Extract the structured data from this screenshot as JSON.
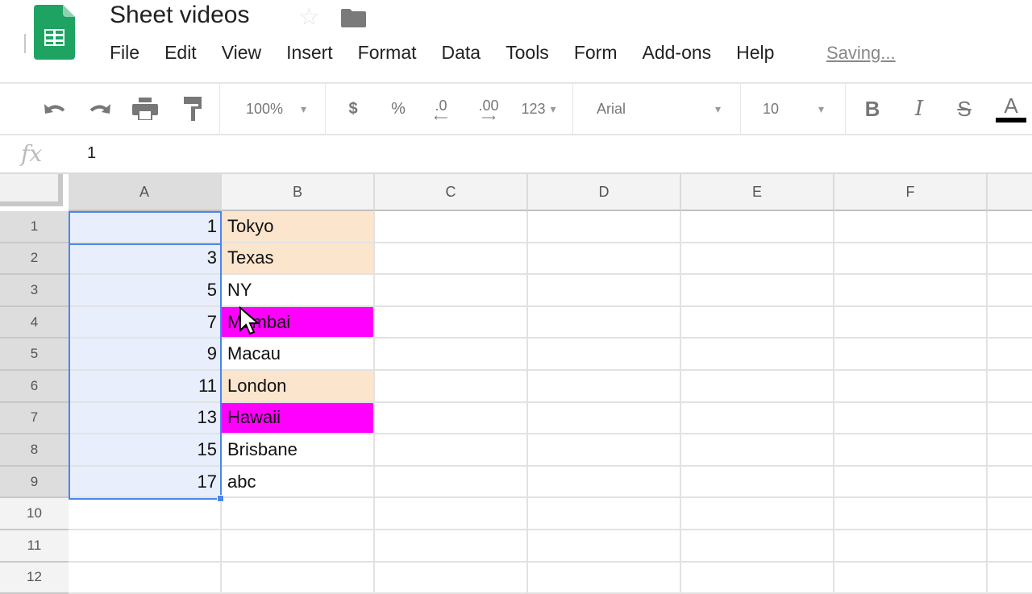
{
  "app": {
    "title": "Sheet videos",
    "status": "Saving...",
    "icons": {
      "logo": "sheets-logo-icon",
      "star": "star-icon",
      "folder": "folder-icon"
    }
  },
  "menu": [
    "File",
    "Edit",
    "View",
    "Insert",
    "Format",
    "Data",
    "Tools",
    "Form",
    "Add-ons",
    "Help"
  ],
  "toolbar": {
    "undo": "undo-icon",
    "redo": "redo-icon",
    "print": "print-icon",
    "paint_format": "paint-format-icon",
    "zoom": "100%",
    "currency": "$",
    "percent": "%",
    "decrease_decimal": ".0",
    "increase_decimal": ".00",
    "number_format": "123",
    "font": "Arial",
    "font_size": "10",
    "bold": "B",
    "italic": "I",
    "strikethrough": "S",
    "text_color": "A",
    "text_color_value": "#000000"
  },
  "formula_bar": {
    "label": "fx",
    "value": "1"
  },
  "grid": {
    "columns": [
      "A",
      "B",
      "C",
      "D",
      "E",
      "F"
    ],
    "rows": [
      "1",
      "2",
      "3",
      "4",
      "5",
      "6",
      "7",
      "8",
      "9",
      "10",
      "11",
      "12"
    ],
    "selected_range": "A1:A9",
    "active_cell": "A1",
    "colA": [
      "1",
      "3",
      "5",
      "7",
      "9",
      "11",
      "13",
      "15",
      "17"
    ],
    "colB": [
      {
        "text": "Tokyo",
        "bg": "#fce5cd"
      },
      {
        "text": "Texas",
        "bg": "#fce5cd"
      },
      {
        "text": "NY",
        "bg": "#ffffff"
      },
      {
        "text": "Mumbai",
        "bg": "#ff00ff"
      },
      {
        "text": "Macau",
        "bg": "#ffffff"
      },
      {
        "text": "London",
        "bg": "#fce5cd"
      },
      {
        "text": "Hawaii",
        "bg": "#ff00ff"
      },
      {
        "text": "Brisbane",
        "bg": "#ffffff"
      },
      {
        "text": "abc",
        "bg": "#ffffff"
      }
    ]
  },
  "colors": {
    "accent": "#4a86e8",
    "selection_fill": "#e8eefb",
    "peach": "#fce5cd",
    "magenta": "#ff00ff",
    "brand_green": "#0f9d58"
  }
}
